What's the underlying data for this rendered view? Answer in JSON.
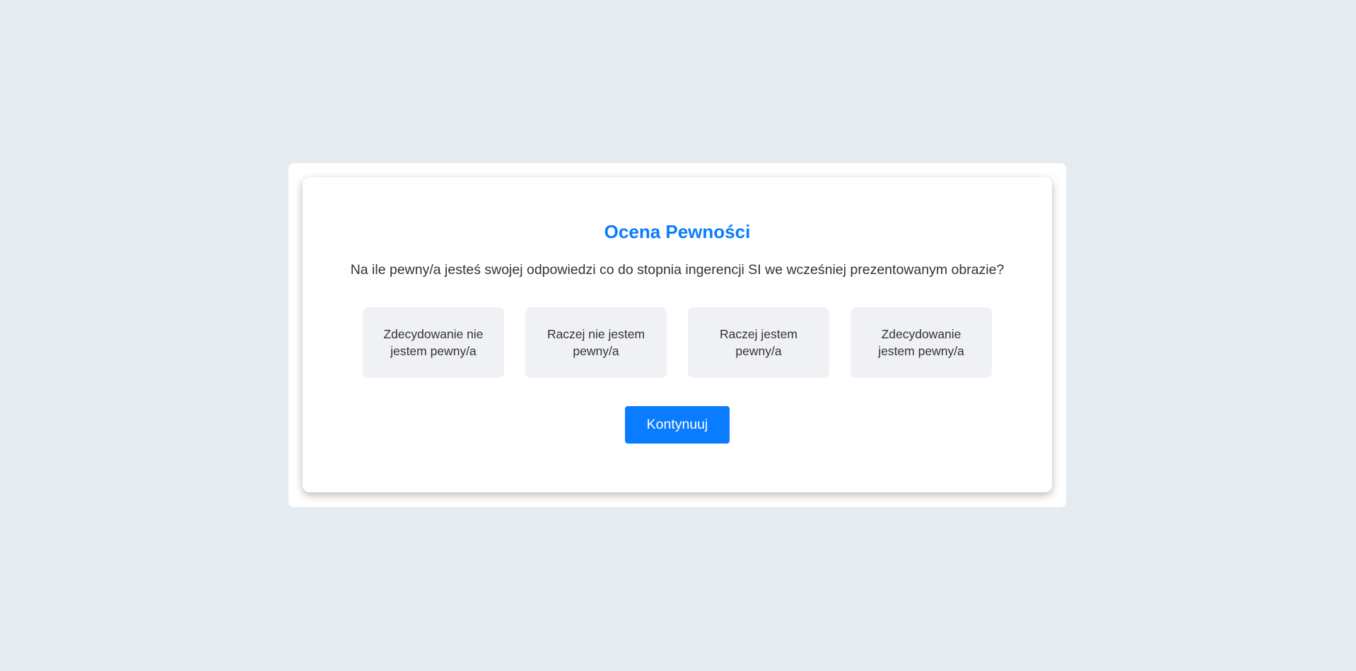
{
  "dialog": {
    "title": "Ocena Pewności",
    "question": "Na ile pewny/a jesteś swojej odpowiedzi co do stopnia ingerencji SI we wcześniej prezentowanym obrazie?",
    "options": [
      {
        "label": "Zdecydowanie nie jestem pewny/a"
      },
      {
        "label": "Raczej nie jestem pewny/a"
      },
      {
        "label": "Raczej jestem pewny/a"
      },
      {
        "label": "Zdecydowanie jestem pewny/a"
      }
    ],
    "continue_label": "Kontynuuj"
  },
  "colors": {
    "accent": "#0a7cff",
    "background": "#e6ebf0",
    "option_background": "#eff1f5",
    "text": "#333333"
  }
}
